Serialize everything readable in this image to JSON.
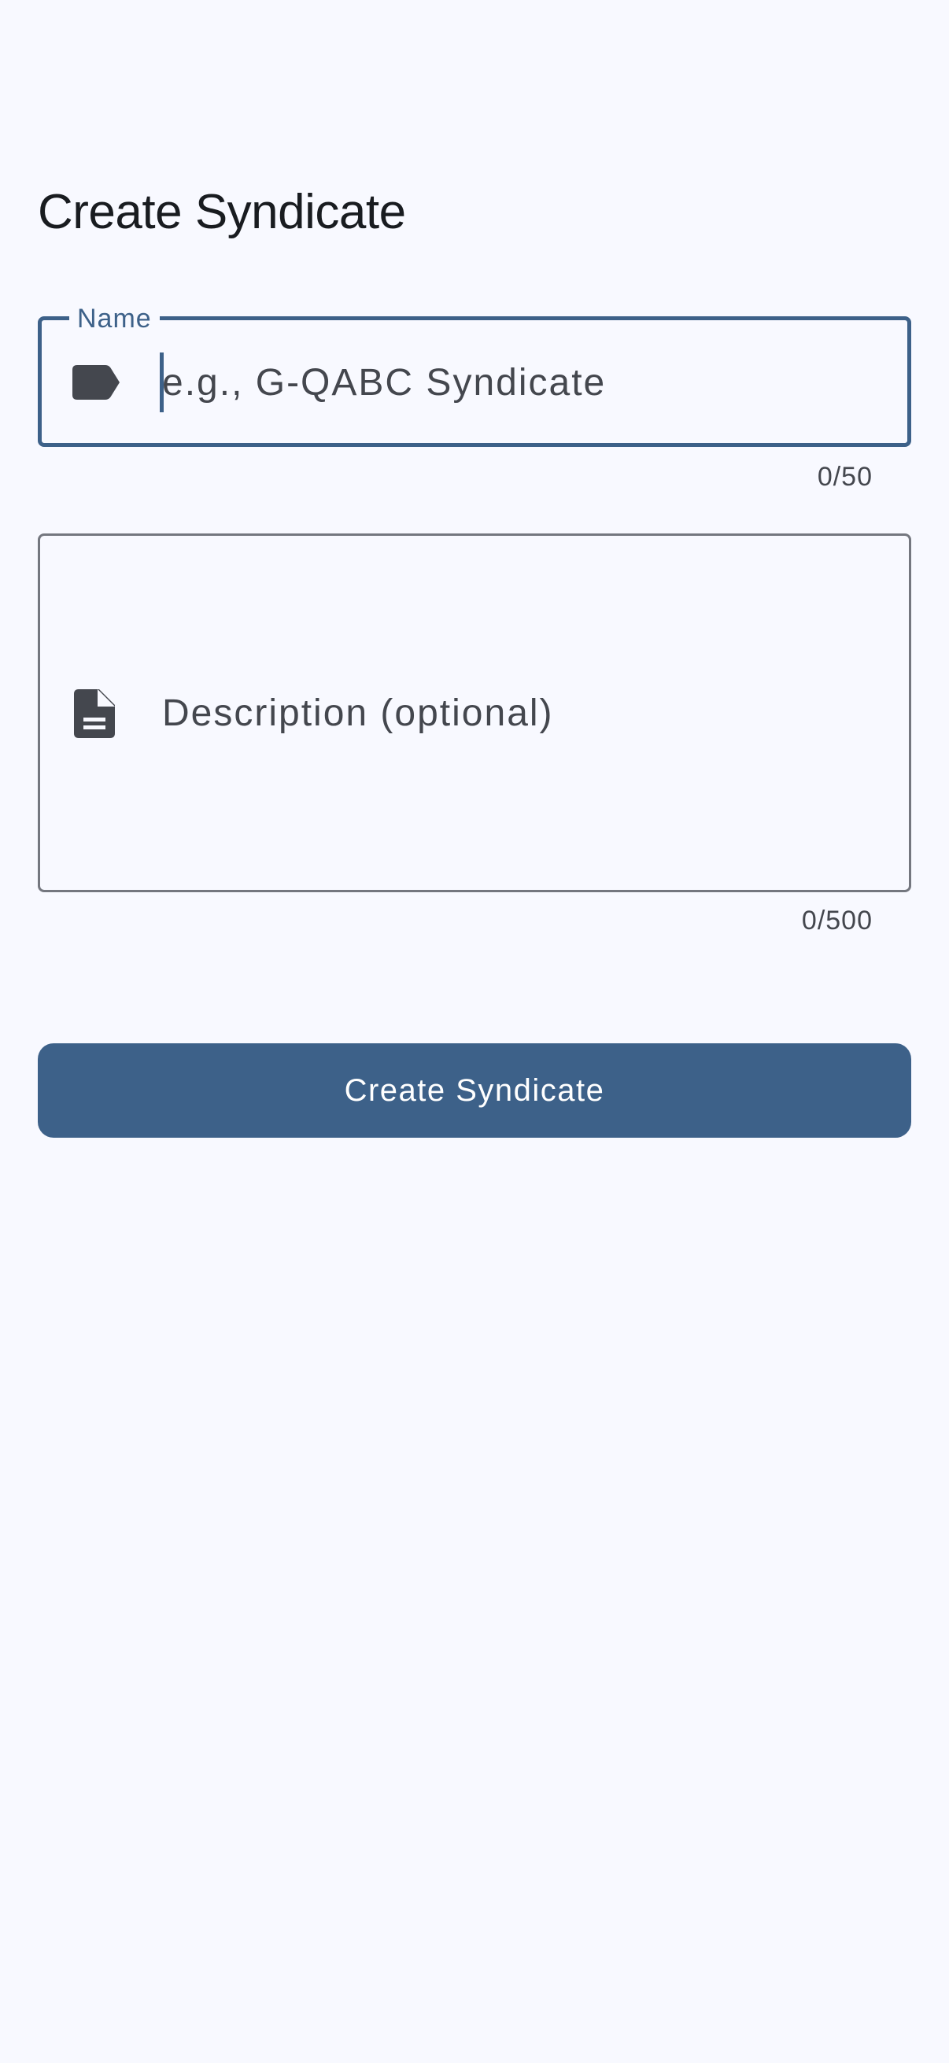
{
  "page": {
    "title": "Create Syndicate"
  },
  "form": {
    "name": {
      "label": "Name",
      "placeholder": "e.g., G-QABC Syndicate",
      "value": "",
      "counter": "0/50",
      "icon": "label-icon"
    },
    "description": {
      "placeholder": "Description (optional)",
      "value": "",
      "counter": "0/500",
      "icon": "description-icon"
    },
    "submit_label": "Create Syndicate"
  },
  "colors": {
    "primary": "#3d6189",
    "background": "#f8f9ff",
    "outline": "#74777f",
    "icon": "#44474e"
  }
}
